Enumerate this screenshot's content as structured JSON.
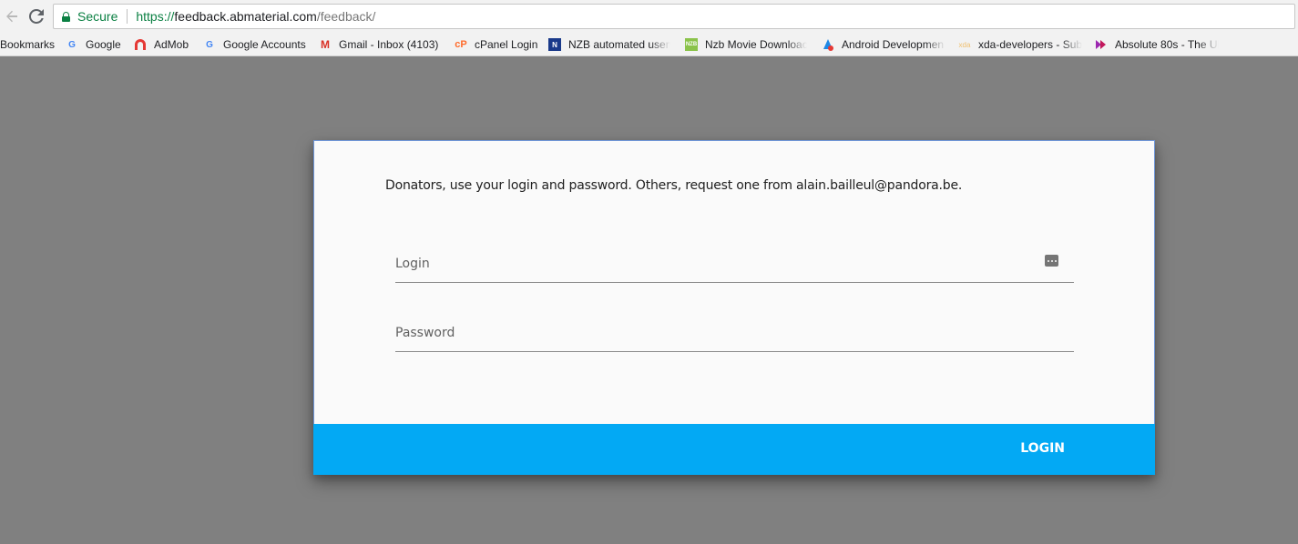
{
  "browser": {
    "secure_label": "Secure",
    "url_scheme": "https://",
    "url_host": "feedback.abmaterial.com",
    "url_path": "/feedback/",
    "bookmarks_label": "Bookmarks",
    "bookmarks": [
      {
        "label": "Google",
        "icon": "google-icon",
        "color": "#4285f4"
      },
      {
        "label": "AdMob",
        "icon": "admob-icon",
        "color": "#e53935"
      },
      {
        "label": "Google Accounts",
        "icon": "google-icon",
        "color": "#4285f4"
      },
      {
        "label": "Gmail - Inbox (4103)",
        "icon": "gmail-icon",
        "color": "#d93025"
      },
      {
        "label": "cPanel Login",
        "icon": "cpanel-icon",
        "color": "#ff6c2c"
      },
      {
        "label": "NZB automated usen",
        "icon": "nzb-icon",
        "color": "#1a3a8a"
      },
      {
        "label": "Nzb Movie Downloac",
        "icon": "nzb-movie-icon",
        "color": "#8bc34a"
      },
      {
        "label": "Android Developmen",
        "icon": "android-dev-icon",
        "color": "#1e88e5"
      },
      {
        "label": "xda-developers - Sub",
        "icon": "xda-icon",
        "color": "#f0a030"
      },
      {
        "label": "Absolute 80s - The Ul",
        "icon": "absolute-80s-icon",
        "color": "#9c27b0"
      }
    ]
  },
  "login_card": {
    "intro": "Donators, use your login and password. Others, request one from alain.bailleul@pandora.be.",
    "login_placeholder": "Login",
    "password_placeholder": "Password",
    "login_button": "LOGIN",
    "accent_color": "#03a9f4"
  }
}
